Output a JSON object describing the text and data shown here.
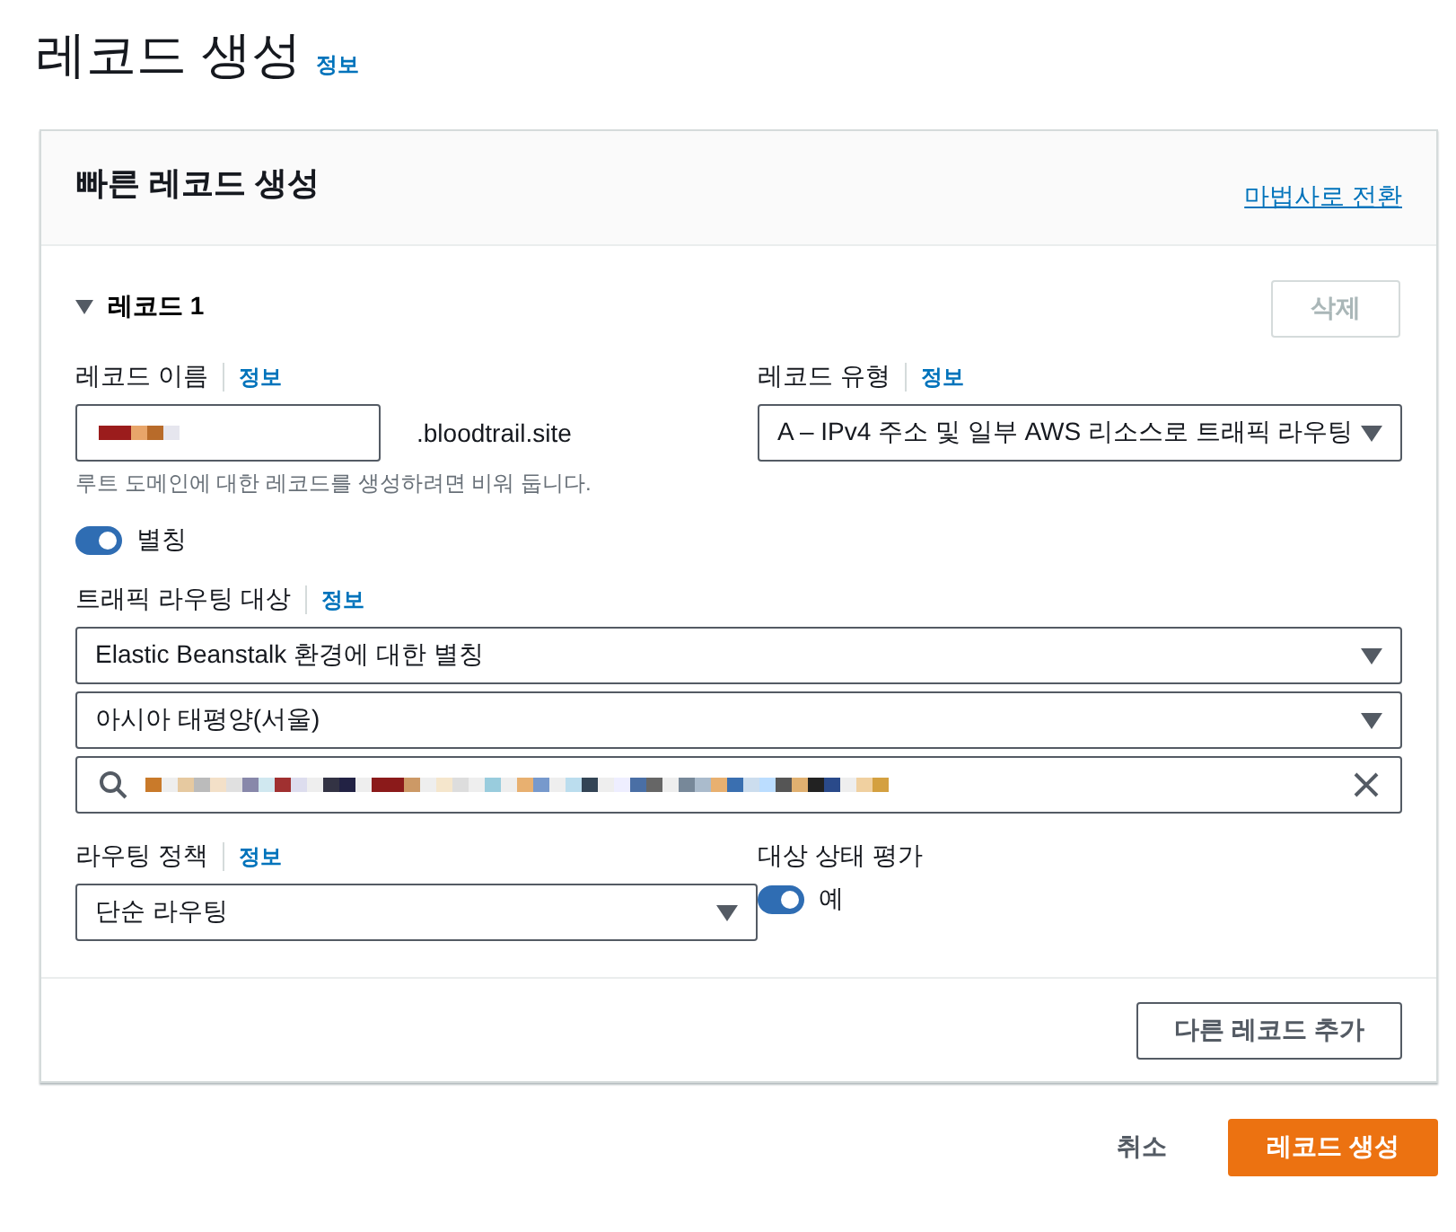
{
  "page": {
    "title": "레코드 생성",
    "info_link": "정보"
  },
  "card": {
    "title": "빠른 레코드 생성",
    "header_link": "마법사로 전환",
    "record": {
      "title": "레코드 1",
      "expanded": true,
      "delete_button": {
        "label": "삭제",
        "disabled": true
      },
      "name_field": {
        "label": "레코드 이름",
        "info_link": "정보",
        "suffix": ".bloodtrail.site",
        "hint": "루트 도메인에 대한 레코드를 생성하려면 비워 둡니다."
      },
      "type_field": {
        "label": "레코드 유형",
        "info_link": "정보",
        "value": "A – IPv4 주소 및 일부 AWS 리소스로 트래픽 라우팅"
      },
      "alias_toggle": {
        "label": "별칭",
        "on": true
      },
      "target": {
        "label": "트래픽 라우팅 대상",
        "info_link": "정보",
        "selects": [
          {
            "value": "Elastic Beanstalk 환경에 대한 별칭"
          },
          {
            "value": "아시아 태평양(서울)"
          }
        ]
      },
      "policy_field": {
        "label": "라우팅 정책",
        "info_link": "정보",
        "value": "단순 라우팅"
      },
      "health": {
        "label": "대상 상태 평가",
        "toggle_label": "예",
        "on": true
      }
    },
    "footer_button": "다른 레코드 추가"
  },
  "actions": {
    "cancel": "취소",
    "create": "레코드 생성"
  }
}
